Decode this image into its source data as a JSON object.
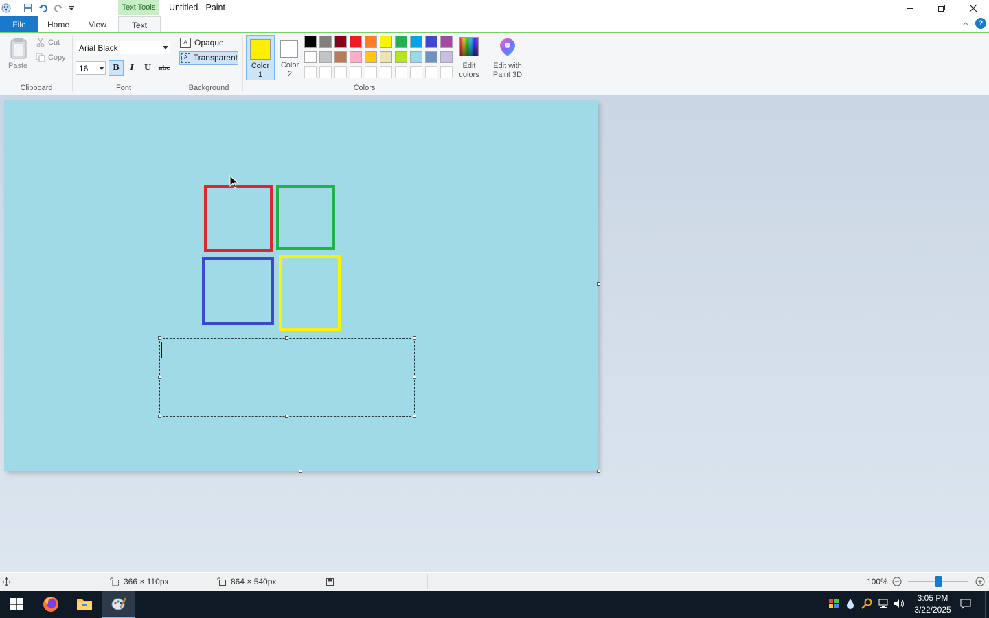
{
  "window": {
    "title": "Untitled - Paint",
    "contextual_tab": "Text Tools"
  },
  "tabs": [
    {
      "label": "File"
    },
    {
      "label": "Home"
    },
    {
      "label": "View"
    },
    {
      "label": "Text"
    }
  ],
  "clipboard": {
    "paste_label": "Paste",
    "cut_label": "Cut",
    "copy_label": "Copy",
    "group_label": "Clipboard"
  },
  "font": {
    "family_value": "Arial Black",
    "size_value": "16",
    "bold_label": "B",
    "italic_label": "I",
    "underline_label": "U",
    "strike_label": "abc",
    "group_label": "Font"
  },
  "background": {
    "opaque_label": "Opaque",
    "transparent_label": "Transparent",
    "group_label": "Background"
  },
  "colors": {
    "color1_label_line1": "Color",
    "color1_label_line2": "1",
    "color1_value": "#ffee00",
    "color2_label_line1": "Color",
    "color2_label_line2": "2",
    "color2_value": "#ffffff",
    "palette_row1": [
      "#000000",
      "#7f7f7f",
      "#880015",
      "#ed1c24",
      "#ff7f27",
      "#fff200",
      "#22b14c",
      "#00a2e8",
      "#3f48cc",
      "#a349a4"
    ],
    "palette_row2": [
      "#ffffff",
      "#c3c3c3",
      "#b97a57",
      "#ffaec9",
      "#ffc90e",
      "#efe4b0",
      "#b5e61d",
      "#99d9ea",
      "#7092be",
      "#c8bfe7"
    ],
    "edit_colors_line1": "Edit",
    "edit_colors_line2": "colors",
    "paint3d_line1": "Edit with",
    "paint3d_line2": "Paint 3D",
    "group_label": "Colors"
  },
  "canvas": {
    "background": "#9fdae6",
    "shapes": [
      {
        "name": "red-square",
        "color": "#d9292f"
      },
      {
        "name": "green-square",
        "color": "#22b14c"
      },
      {
        "name": "blue-square",
        "color": "#3f48cc"
      },
      {
        "name": "yellow-square",
        "color": "#fff200"
      }
    ]
  },
  "status": {
    "selection_size": "366 × 110px",
    "canvas_size": "864 × 540px",
    "zoom": "100%"
  },
  "taskbar": {
    "time": "3:05 PM",
    "date": "3/22/2025"
  }
}
